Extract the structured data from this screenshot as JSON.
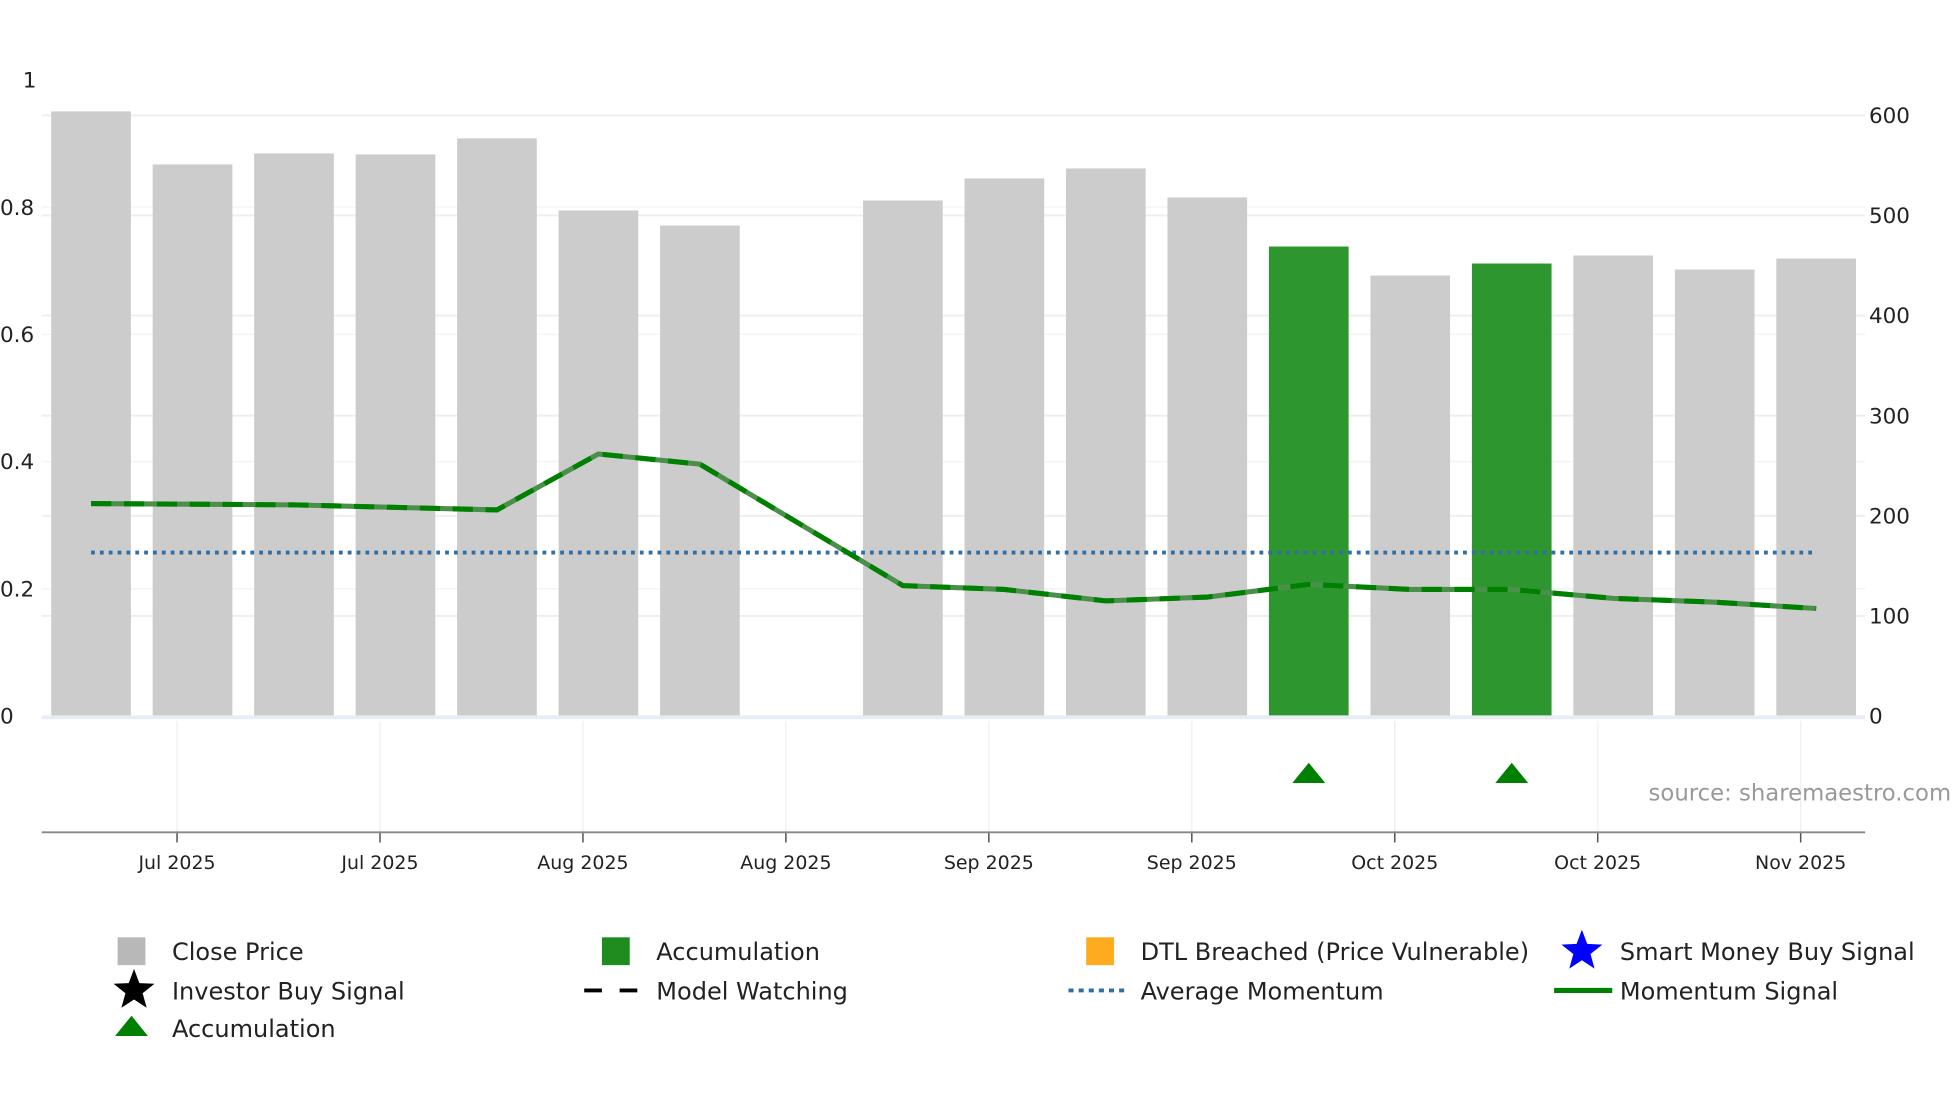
{
  "chart_data": {
    "type": "bar",
    "title": "",
    "x_ticks": [
      "Jul 2025",
      "Jul 2025",
      "Aug 2025",
      "Aug 2025",
      "Sep 2025",
      "Sep 2025",
      "Oct 2025",
      "Oct 2025",
      "Nov 2025"
    ],
    "left_axis": {
      "ticks": [
        "0",
        "0.2",
        "0.4",
        "0.6",
        "0.8",
        "1"
      ],
      "range": [
        0,
        1
      ]
    },
    "right_axis": {
      "ticks": [
        "0",
        "100",
        "200",
        "300",
        "400",
        "500",
        "600"
      ],
      "range": [
        0,
        635
      ]
    },
    "weeks": 18,
    "series": [
      {
        "name": "Close Price",
        "type": "bar",
        "axis": "right",
        "color": "#cccccc",
        "values": [
          604,
          551,
          562,
          561,
          577,
          505,
          490,
          null,
          515,
          537,
          547,
          518,
          469,
          440,
          452,
          460,
          446,
          457
        ]
      },
      {
        "name": "Accumulation",
        "type": "bar-highlight",
        "color": "#2e962e",
        "indices": [
          12,
          14
        ]
      },
      {
        "name": "Momentum Signal",
        "type": "line",
        "axis": "left",
        "color": "#008000",
        "values": [
          0.334,
          0.333,
          0.332,
          0.328,
          0.324,
          0.412,
          0.396,
          null,
          0.205,
          0.199,
          0.181,
          0.187,
          0.207,
          0.199,
          0.199,
          0.185,
          0.179,
          0.169
        ]
      },
      {
        "name": "Average Momentum",
        "type": "hline",
        "axis": "left",
        "color": "#2f6fa5",
        "value": 0.257
      },
      {
        "name": "Accumulation markers",
        "type": "marker",
        "color": "#008000",
        "indices": [
          12,
          14
        ]
      }
    ],
    "annotation": "source: sharemaestro.com",
    "legend": {
      "placement": "bottom",
      "items": [
        {
          "label": "Close Price",
          "icon": "gray-square",
          "color": "#b8b8b8"
        },
        {
          "label": "Accumulation",
          "icon": "green-square",
          "color": "#1e8c1e"
        },
        {
          "label": "DTL Breached (Price Vulnerable)",
          "icon": "orange-square",
          "color": "#ffab1f"
        },
        {
          "label": "Smart Money Buy Signal",
          "icon": "blue-star",
          "color": "#0000ff"
        },
        {
          "label": "Investor Buy Signal",
          "icon": "black-star",
          "color": "#000000"
        },
        {
          "label": "Model Watching",
          "icon": "black-dashed-line",
          "color": "#000000"
        },
        {
          "label": "Average Momentum",
          "icon": "blue-dotted-line",
          "color": "#2f6fa5"
        },
        {
          "label": "Momentum Signal",
          "icon": "green-line",
          "color": "#008000"
        },
        {
          "label": "Accumulation",
          "icon": "green-triangle",
          "color": "#008000"
        }
      ]
    }
  }
}
